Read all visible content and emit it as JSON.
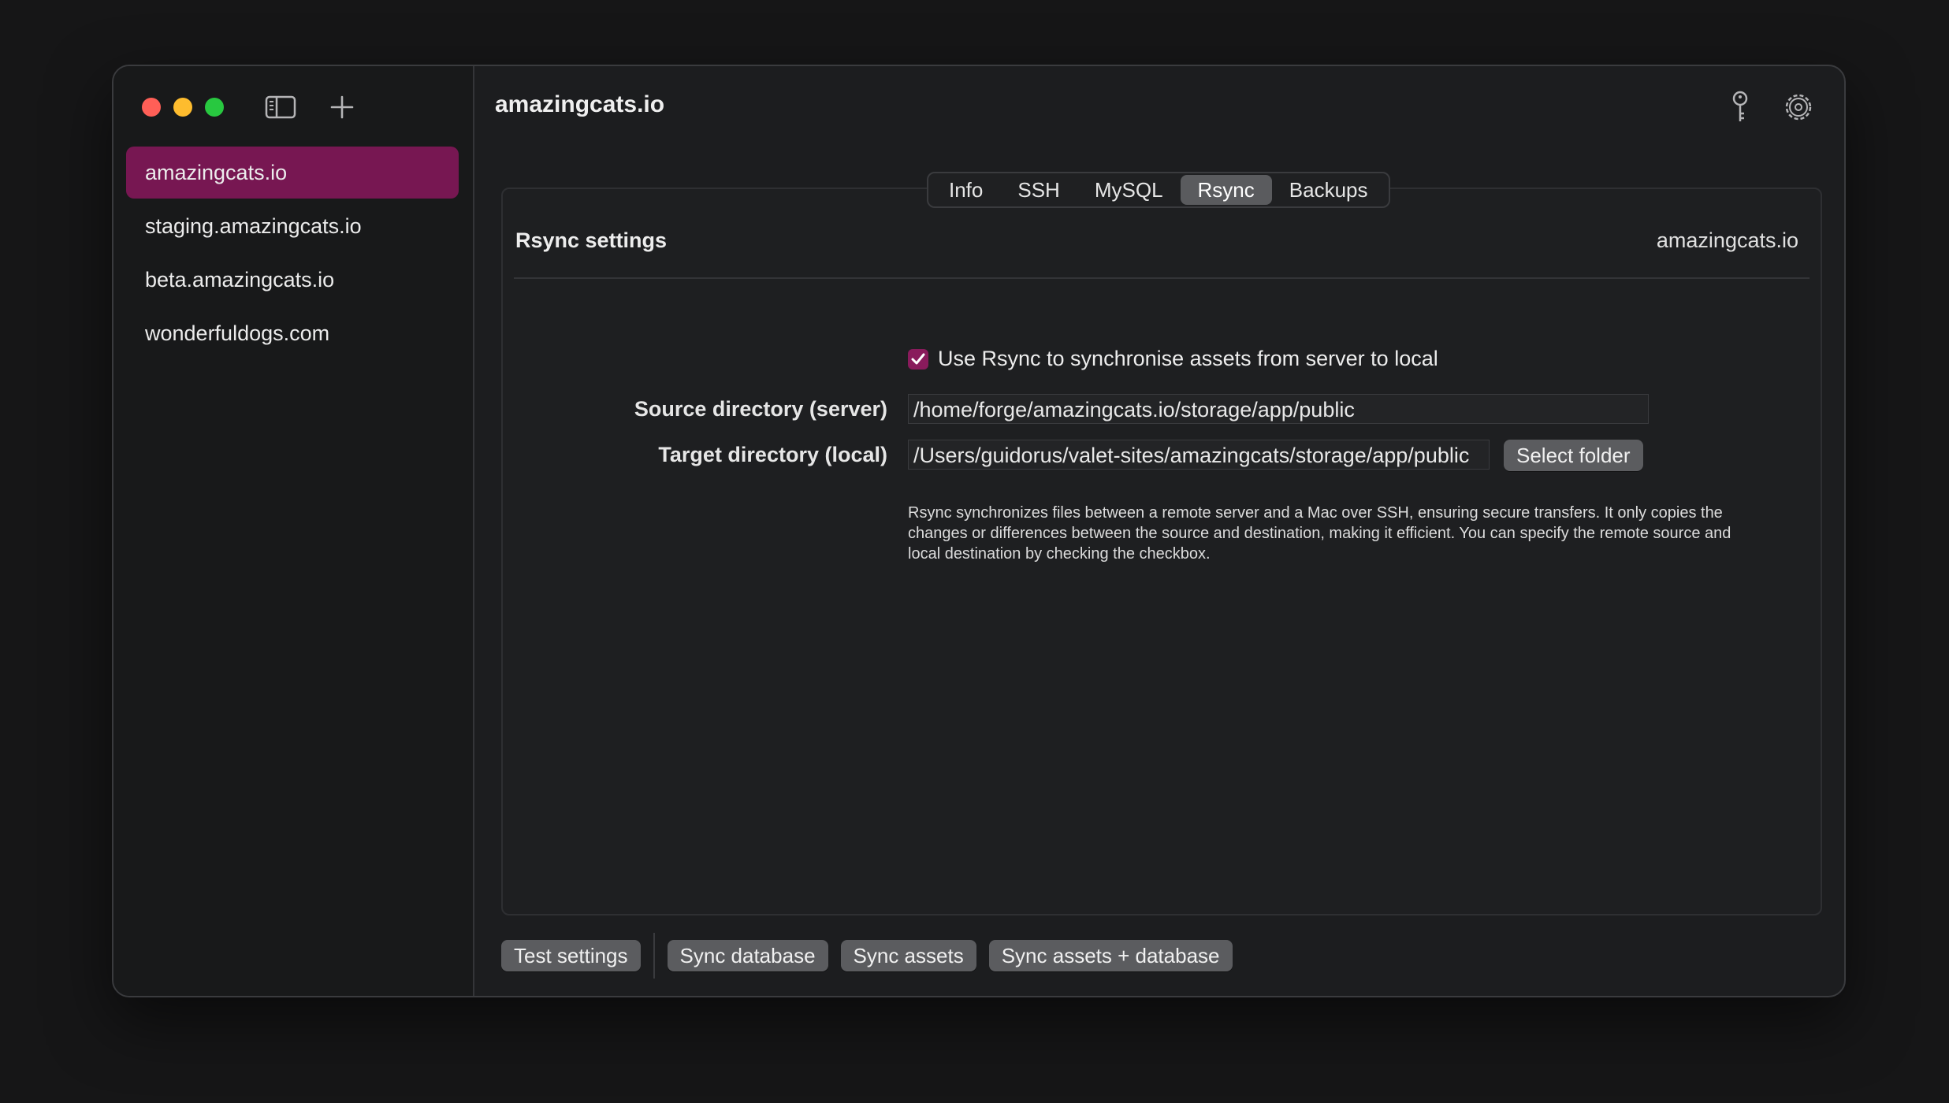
{
  "window": {
    "title": "amazingcats.io"
  },
  "sidebar": {
    "items": [
      {
        "label": "amazingcats.io",
        "selected": true
      },
      {
        "label": "staging.amazingcats.io"
      },
      {
        "label": "beta.amazingcats.io"
      },
      {
        "label": "wonderfuldogs.com"
      }
    ]
  },
  "icons": {
    "sidebar_toggle": "sidebar-toggle-icon",
    "add": "plus-icon",
    "key": "key-icon",
    "settings": "gear-icon"
  },
  "tabs": [
    {
      "label": "Info"
    },
    {
      "label": "SSH"
    },
    {
      "label": "MySQL"
    },
    {
      "label": "Rsync",
      "active": true
    },
    {
      "label": "Backups"
    }
  ],
  "panel": {
    "title": "Rsync settings",
    "site": "amazingcats.io",
    "checkbox_label": "Use Rsync to synchronise assets from server to local",
    "checkbox_checked": true,
    "source_label": "Source directory (server)",
    "source_value": "/home/forge/amazingcats.io/storage/app/public",
    "target_label": "Target directory (local)",
    "target_value": "/Users/guidorus/valet-sites/amazingcats/storage/app/public",
    "select_folder": "Select folder",
    "description": "Rsync synchronizes files between a remote server and a Mac over SSH, ensuring secure transfers. It only copies the changes or differences between the source and destination, making it efficient. You can specify the remote source and local destination by checking the checkbox."
  },
  "bottom": {
    "test_settings": "Test settings",
    "sync_database": "Sync database",
    "sync_assets": "Sync assets",
    "sync_both": "Sync assets + database"
  },
  "colors": {
    "accent": "#771752",
    "checkbox": "#891b5c",
    "background": "#161617",
    "window": "#1c1d1f"
  }
}
